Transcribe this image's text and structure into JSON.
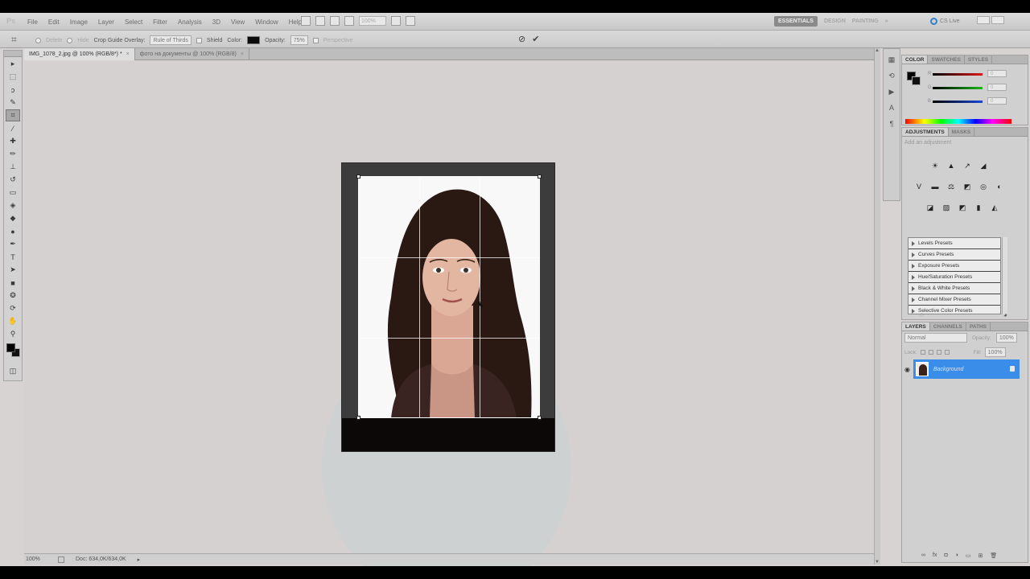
{
  "menubar": {
    "logo": "Ps",
    "menus": [
      "File",
      "Edit",
      "Image",
      "Layer",
      "Select",
      "Filter",
      "Analysis",
      "3D",
      "View",
      "Window",
      "Help"
    ],
    "zoom_value": "100%",
    "workspaces": [
      "ESSENTIALS",
      "DESIGN",
      "PAINTING"
    ],
    "more": "»",
    "cs_live": "CS Live"
  },
  "options": {
    "delete_label": "Delete",
    "hide_label": "Hide",
    "overlay_label": "Crop Guide Overlay:",
    "overlay_value": "Rule of Thirds",
    "shield_label": "Shield",
    "color_label": "Color:",
    "opacity_label": "Opacity:",
    "opacity_value": "75%",
    "perspective_label": "Perspective",
    "cancel_glyph": "⊘",
    "commit_glyph": "✔"
  },
  "doc_tabs": [
    {
      "label": "IMG_1078_2.jpg @ 100% (RGB/8*) *",
      "close": "×"
    },
    {
      "label": "фото на документы @ 100% (RGB/8)",
      "close": "×"
    }
  ],
  "status": {
    "zoom": "100%",
    "doc": "Doc: 634,0K/634,0K"
  },
  "color_panel": {
    "tabs": [
      "COLOR",
      "SWATCHES",
      "STYLES"
    ],
    "channels": [
      "R",
      "G",
      "B"
    ],
    "values": [
      "0",
      "0",
      "0"
    ],
    "slider_colors": [
      "#e01818",
      "#18b818",
      "#1848d8"
    ]
  },
  "adjust_panel": {
    "tabs": [
      "ADJUSTMENTS",
      "MASKS"
    ],
    "hint": "Add an adjustment",
    "presets": [
      "Levels Presets",
      "Curves Presets",
      "Exposure Presets",
      "Hue/Saturation Presets",
      "Black & White Presets",
      "Channel Mixer Presets",
      "Selective Color Presets"
    ]
  },
  "layers_panel": {
    "tabs": [
      "LAYERS",
      "CHANNELS",
      "PATHS"
    ],
    "blend_mode": "Normal",
    "opacity_label": "Opacity:",
    "opacity_value": "100%",
    "lock_label": "Lock:",
    "fill_label": "Fill:",
    "fill_value": "100%",
    "layer_name": "Background"
  }
}
